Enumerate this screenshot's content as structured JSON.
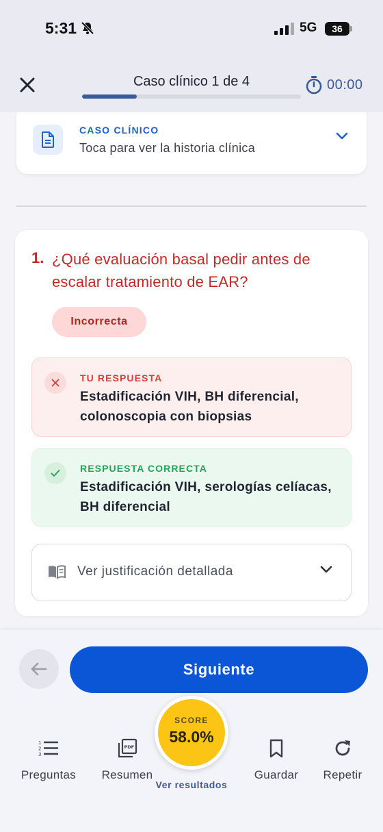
{
  "status_bar": {
    "time": "5:31",
    "network": "5G",
    "battery": "36"
  },
  "header": {
    "title": "Caso clínico 1 de 4",
    "progress": 0.25,
    "timer": "00:00"
  },
  "case_card": {
    "label": "CASO CLÍNICO",
    "subtitle": "Toca para ver la historia clínica"
  },
  "question": {
    "number": "1.",
    "text": "¿Qué evaluación basal pedir antes de escalar tratamiento de EAR?",
    "status": "Incorrecta",
    "your_answer": {
      "label": "TU RESPUESTA",
      "text": "Estadificación VIH, BH diferencial, colonoscopia con biopsias"
    },
    "correct_answer": {
      "label": "RESPUESTA CORRECTA",
      "text": "Estadificación VIH, serologías celíacas, BH diferencial"
    },
    "justification_label": "Ver justificación detallada"
  },
  "footer": {
    "next_label": "Siguiente",
    "nav": {
      "preguntas": "Preguntas",
      "resumen": "Resumen",
      "guardar": "Guardar",
      "repetir": "Repetir"
    },
    "score_label": "SCORE",
    "score_value": "58.0%",
    "see_results": "Ver resultados"
  },
  "colors": {
    "primary": "#0a56d6",
    "error": "#c62828",
    "success": "#22a35a",
    "score": "#fcc515"
  },
  "icons": {
    "close": "close-icon",
    "timer": "stopwatch-icon",
    "case": "document-icon",
    "wrong": "x-icon",
    "right": "check-icon",
    "book": "book-icon",
    "back": "arrow-left-icon",
    "questions": "numbered-list-icon",
    "summary": "pdf-icon",
    "save": "bookmark-icon",
    "repeat": "refresh-icon"
  }
}
